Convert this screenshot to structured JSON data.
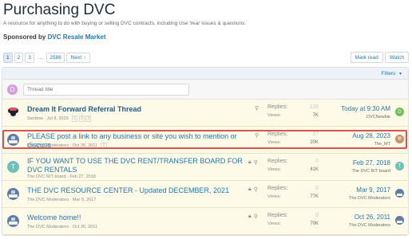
{
  "header": {
    "title": "Purchasing DVC",
    "description": "A resource for anything to do with buying or selling DVC contracts, including Use Year issues & questions.",
    "sponsor_label": "Sponsored by",
    "sponsor_name": "DVC Resale Market"
  },
  "pagination": {
    "pages": [
      "1",
      "2",
      "3",
      "...",
      "2586"
    ],
    "next_label": "Next",
    "active_page": "1"
  },
  "actions": {
    "mark_read": "Mark read",
    "watch": "Watch"
  },
  "filters": {
    "label": "Filters"
  },
  "new_thread": {
    "avatar_letter": "D",
    "placeholder": "Thread title"
  },
  "stat_labels": {
    "replies": "Replies:",
    "views": "Views:"
  },
  "threads": [
    {
      "title": "Dream It Forward Referral Thread",
      "author": "Sandow",
      "date": "Jul 8, 2023",
      "pages": [
        "1",
        "2",
        "3"
      ],
      "replies": "126",
      "views": "7K",
      "latest_date": "Today at 9:30 AM",
      "latest_user": "DVCNewbie",
      "latest_avatar_letter": "D"
    },
    {
      "title": "PLEASE post a link to any business or site you wish to mention or discuss",
      "author": "The DVC Moderators",
      "date": "Oct 26, 2011",
      "pages": [
        "2"
      ],
      "replies": "37",
      "views": "20K",
      "latest_date": "Aug 28, 2023",
      "latest_user": "The_MT",
      "latest_avatar_letter": ""
    },
    {
      "title": "IF YOU WANT TO USE THE DVC RENT/TRANSFER BOARD FOR DVC RENTALS",
      "author": "The DVC R/T board",
      "date": "Feb 27, 2018",
      "pages": [],
      "replies": "0",
      "views": "41K",
      "latest_date": "Feb 27, 2018",
      "latest_user": "The DVC R/T board",
      "latest_avatar_letter": "T"
    },
    {
      "title": "THE DVC RESOURCE CENTER - Updated DECEMBER, 2021",
      "author": "The DVC Moderators",
      "date": "Mar 9, 2017",
      "pages": [],
      "replies": "0",
      "views": "77K",
      "latest_date": "Mar 9, 2017",
      "latest_user": "The DVC Moderators",
      "latest_avatar_letter": ""
    },
    {
      "title": "Welcome home!!",
      "author": "The DVC Moderators",
      "date": "Oct 26, 2011",
      "pages": [],
      "replies": "0",
      "views": "70K",
      "latest_date": "Oct 26, 2011",
      "latest_user": "The DVC Moderators",
      "latest_avatar_letter": ""
    }
  ],
  "colors": {
    "accent": "#2577b1",
    "sticky_bg": "#fdfae8",
    "highlight": "#d9534f"
  }
}
